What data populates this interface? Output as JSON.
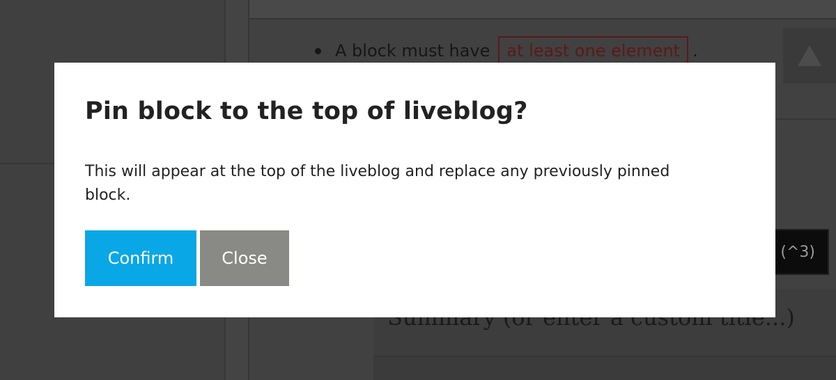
{
  "background": {
    "rule_prefix": "A block must have",
    "rule_highlight": "at least one element",
    "rule_suffix": ".",
    "dark_button_label": "(^3)",
    "summary_placeholder": "Summary (or enter a custom title...)"
  },
  "dialog": {
    "title": "Pin block to the top of liveblog?",
    "message": "This will appear at the top of the liveblog and replace any previously pinned block.",
    "confirm_label": "Confirm",
    "close_label": "Close"
  },
  "colors": {
    "confirm": "#0aa7e6",
    "close": "#898985",
    "overlay": "#3f3f3f"
  }
}
